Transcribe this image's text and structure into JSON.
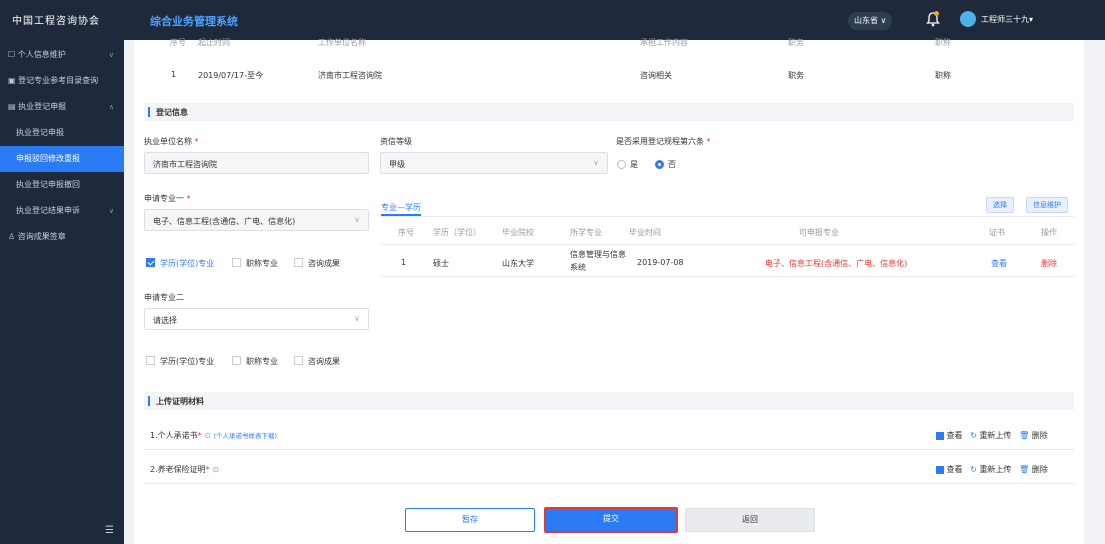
{
  "header": {
    "logo": "中国工程咨询协会",
    "system_title": "综合业务管理系统",
    "province": "山东省",
    "province_chevron": "∨",
    "username": "工程师三十九"
  },
  "sidebar": {
    "items": [
      {
        "label": "个人信息维护"
      },
      {
        "label": "登记专业参考目录查询"
      },
      {
        "label": "执业登记申报"
      },
      {
        "label": "执业登记申报"
      },
      {
        "label": "申报驳回修改重报"
      },
      {
        "label": "执业登记申报撤回"
      },
      {
        "label": "执业登记结果申诉"
      },
      {
        "label": "咨询成果签章"
      }
    ]
  },
  "work_history": {
    "headers": [
      "序号",
      "起止时间",
      "工作单位名称",
      "承担工作内容",
      "职务",
      "职称"
    ],
    "row": {
      "no": "1",
      "period": "2019/07/17-至今",
      "company": "济南市工程咨询院",
      "content": "咨询相关",
      "duty": "职务",
      "title": "职称"
    }
  },
  "reg_info": {
    "section_title": "登记信息",
    "unit_label": "执业单位名称",
    "unit_value": "济南市工程咨询院",
    "grade_label": "资信等级",
    "grade_value": "甲级",
    "rule6_label": "是否采用登记规程第六条",
    "rule6_yes": "是",
    "rule6_no": "否",
    "major1_label": "申请专业一",
    "major1_value": "电子、信息工程(含通信、广电、信息化)",
    "major1_checks": [
      "学历(学位)专业",
      "职称专业",
      "咨询成果"
    ],
    "major2_label": "申请专业二",
    "major2_placeholder": "请选择",
    "major2_checks": [
      "学历(学位)专业",
      "职称专业",
      "咨询成果"
    ],
    "tab_label": "专业—学历",
    "select_btn": "选择",
    "maintain_btn": "信息维护",
    "edu_headers": [
      "序号",
      "学历（学位）",
      "毕业院校",
      "所学专业",
      "毕业时间",
      "可申报专业",
      "证书",
      "操作"
    ],
    "edu_row": {
      "no": "1",
      "degree": "硕士",
      "school": "山东大学",
      "major_line1": "信息管理与信息",
      "major_line2": "系统",
      "date": "2019-07-08",
      "applicable": "电子、信息工程(含通信、广电、信息化)",
      "cert": "查看",
      "op": "删除"
    }
  },
  "materials": {
    "section_title": "上传证明材料",
    "items": [
      {
        "label": "1.个人承诺书",
        "link": "(个人承诺书样表下载)"
      },
      {
        "label": "2.养老保险证明",
        "link": ""
      }
    ],
    "view": "查看",
    "reupload": "重新上传",
    "delete": "删除"
  },
  "actions": {
    "save": "暂存",
    "submit": "提交",
    "back": "返回"
  },
  "colors": {
    "accent": "#2b7bf5",
    "sidebar_bg": "#1e2a3c",
    "danger": "#e53935"
  }
}
